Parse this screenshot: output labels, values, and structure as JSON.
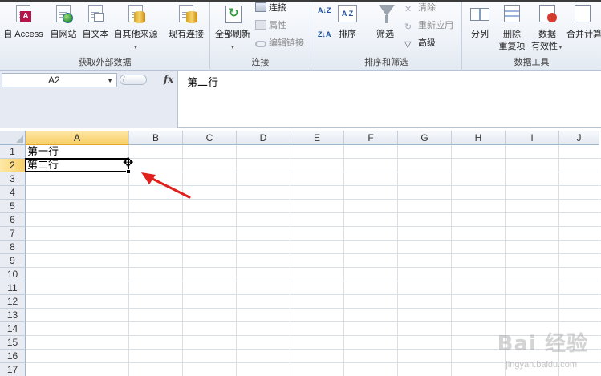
{
  "ribbon": {
    "groups": [
      {
        "label": "获取外部数据"
      },
      {
        "label": "连接"
      },
      {
        "label": "排序和筛选"
      },
      {
        "label": "数据工具"
      }
    ],
    "external": {
      "access": "自 Access",
      "web": "自网站",
      "text": "自文本",
      "other": "自其他来源",
      "existing": "现有连接"
    },
    "connections": {
      "refresh_all": "全部刷新",
      "connections": "连接",
      "properties": "属性",
      "edit_links": "编辑链接"
    },
    "sort_filter": {
      "sort": "排序",
      "filter": "筛选",
      "clear": "清除",
      "reapply": "重新应用",
      "advanced": "高级"
    },
    "data_tools": {
      "split": "分列",
      "remove_dup_line1": "删除",
      "remove_dup_line2": "重复项",
      "validation_line1": "数据",
      "validation_line2": "有效性",
      "consolidate": "合并计算"
    },
    "icons": {
      "sort_az": "A↓Z",
      "sort_za": "Z↓A",
      "sort_grid": "A Z"
    }
  },
  "formula_bar": {
    "name_box": "A2",
    "fx": "fx",
    "formula": "第二行"
  },
  "sheet": {
    "columns": [
      "A",
      "B",
      "C",
      "D",
      "E",
      "F",
      "G",
      "H",
      "I",
      "J"
    ],
    "active_column": "A",
    "rows": [
      "1",
      "2",
      "3",
      "4",
      "5",
      "6",
      "7",
      "8",
      "9",
      "10",
      "11",
      "12",
      "13",
      "14",
      "15",
      "16",
      "17"
    ],
    "active_row": "2",
    "cells": {
      "A1": "第一行",
      "A2": "第二行"
    }
  },
  "annotation": {
    "arrow_color": "#e0201b"
  },
  "watermark": {
    "text": "Bai 经验",
    "sub": "jingyan.baidu.com"
  }
}
